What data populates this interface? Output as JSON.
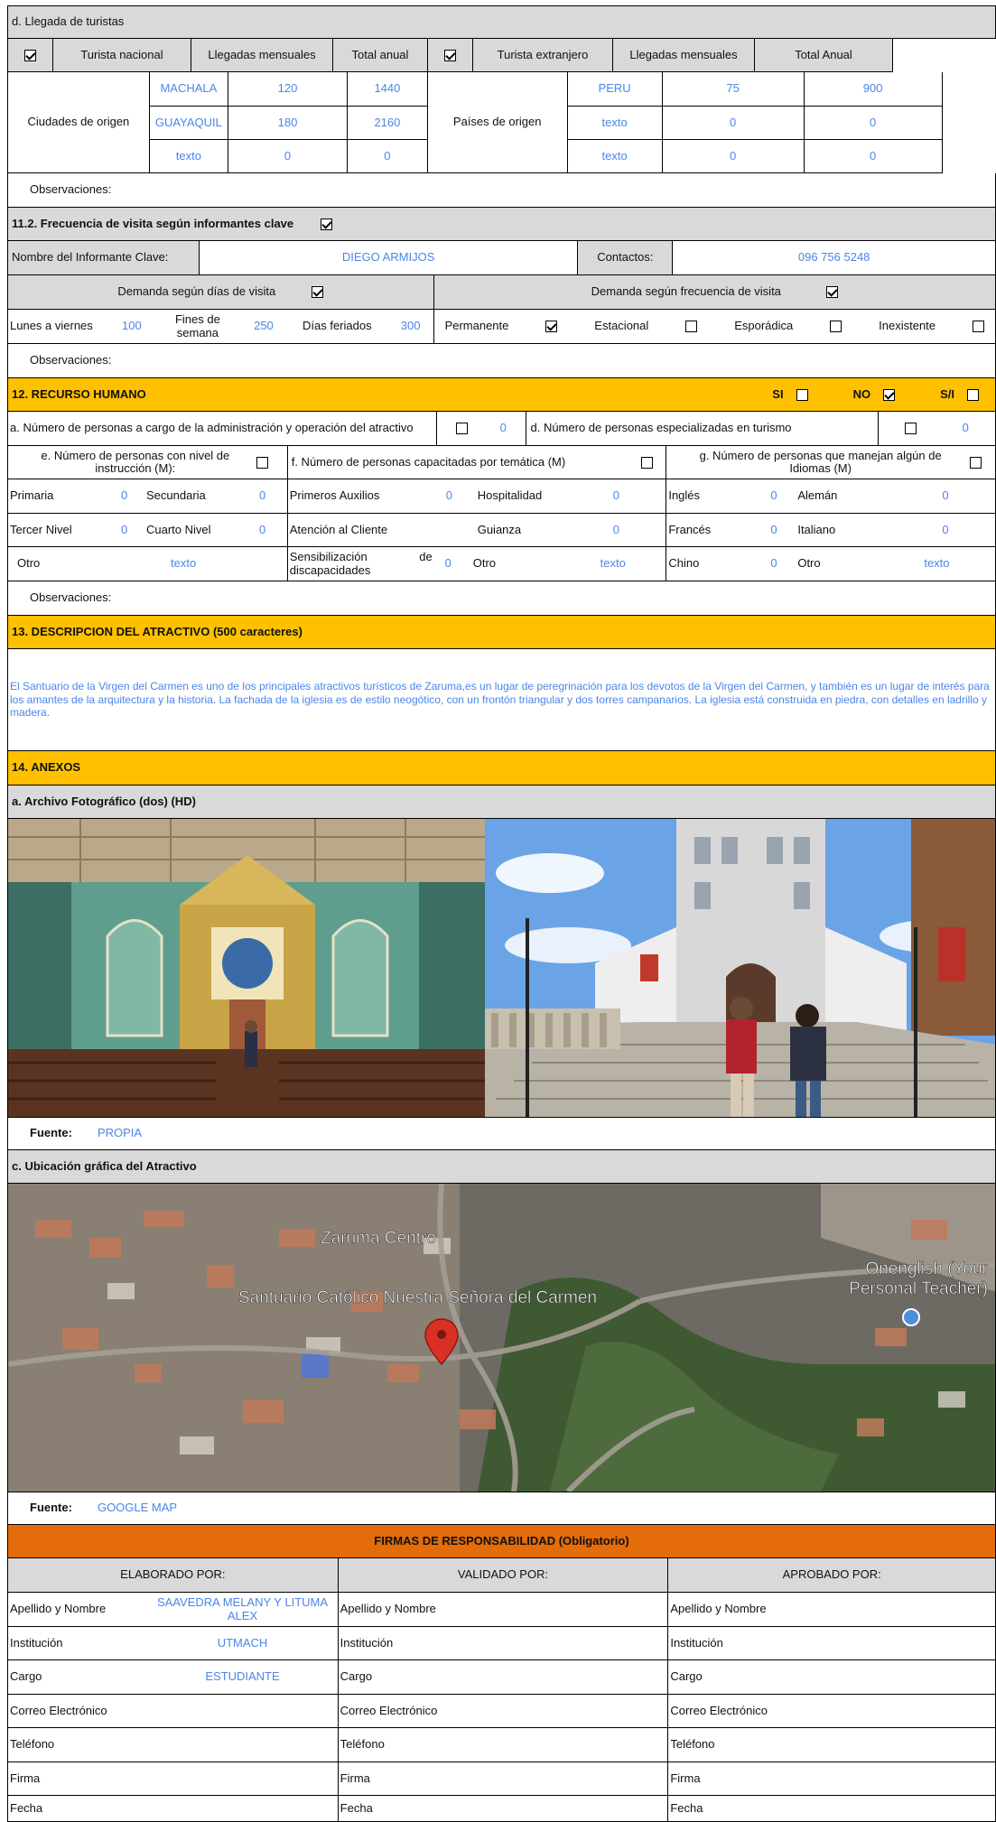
{
  "arrivals": {
    "section_title": "d. Llegada de turistas",
    "national": {
      "label": "Turista nacional",
      "checked": true,
      "col_monthly": "Llegadas mensuales",
      "col_total": "Total anual",
      "origin_label": "Ciudades de origen",
      "rows": [
        {
          "name": "MACHALA",
          "monthly": "120",
          "total": "1440"
        },
        {
          "name": "GUAYAQUIL",
          "monthly": "180",
          "total": "2160"
        },
        {
          "name": "texto",
          "monthly": "0",
          "total": "0"
        }
      ]
    },
    "foreign": {
      "label": "Turista extranjero",
      "checked": true,
      "col_monthly": "Llegadas mensuales",
      "col_total": "Total Anual",
      "origin_label": "Países de origen",
      "rows": [
        {
          "name": "PERU",
          "monthly": "75",
          "total": "900"
        },
        {
          "name": "texto",
          "monthly": "0",
          "total": "0"
        },
        {
          "name": "texto",
          "monthly": "0",
          "total": "0"
        }
      ]
    },
    "observations_label": "Observaciones:"
  },
  "frequency": {
    "title": "11.2. Frecuencia de visita según informantes clave",
    "checked": true,
    "informant_label": "Nombre del Informante Clave:",
    "informant_value": "DIEGO ARMIJOS",
    "contacts_label": "Contactos:",
    "contacts_value": "096 756 5248",
    "days_label": "Demanda según  días de visita",
    "days_checked": true,
    "freq_label": "Demanda según frecuencia de visita",
    "freq_checked": true,
    "weekday_label": "Lunes a viernes",
    "weekday_value": "100",
    "weekend_label": "Fines de semana",
    "weekend_value": "250",
    "holiday_label": "Días feriados",
    "holiday_value": "300",
    "options": [
      {
        "label": "Permanente",
        "checked": true
      },
      {
        "label": "Estacional",
        "checked": false
      },
      {
        "label": "Esporádica",
        "checked": false
      },
      {
        "label": "Inexistente",
        "checked": false
      }
    ],
    "observations_label": "Observaciones:"
  },
  "hr": {
    "title": "12. RECURSO HUMANO",
    "si_label": "SI",
    "si_checked": false,
    "no_label": "NO",
    "no_checked": true,
    "sn_label": "S/I",
    "sn_checked": false,
    "admin_label": "a. Número de personas a cargo de la administración y operación del atractivo",
    "admin_value": "0",
    "specialized_label": "d. Número de personas especializadas en turismo",
    "specialized_value": "0",
    "education_label": "e. Número de personas con nivel de instrucción (M):",
    "trained_label": "f. Número de personas capacitadas por temática (M)",
    "languages_label": "g. Número de personas que manejan algún de Idiomas (M)",
    "edu": {
      "primaria": "Primaria",
      "primaria_v": "0",
      "secundaria": "Secundaria",
      "secundaria_v": "0",
      "tercer": "Tercer Nivel",
      "tercer_v": "0",
      "cuarto": "Cuarto Nivel",
      "cuarto_v": "0",
      "otro": "Otro",
      "otro_v": "texto"
    },
    "trn": {
      "aux": "Primeros Auxilios",
      "aux_v": "0",
      "hosp": "Hospitalidad",
      "hosp_v": "0",
      "cliente": "Atención al Cliente",
      "guianza": "Guianza",
      "guianza_v": "0",
      "sens": "Sensibilización de discapacidades",
      "sens_v": "0",
      "otro": "Otro",
      "otro_v": "texto"
    },
    "lang": {
      "ingles": "Inglés",
      "ingles_v": "0",
      "aleman": "Alemán",
      "aleman_v": "0",
      "frances": "Francés",
      "frances_v": "0",
      "italiano": "Italiano",
      "italiano_v": "0",
      "chino": "Chino",
      "chino_v": "0",
      "otro": "Otro",
      "otro_v": "texto"
    },
    "observations_label": "Observaciones:"
  },
  "description": {
    "title": "13. DESCRIPCION DEL ATRACTIVO (500 caracteres)",
    "text": "El Santuario de la Virgen del Carmen es uno de los principales atractivos turísticos de Zaruma,es un lugar de peregrinación para los devotos de la Virgen del Carmen, y también es un lugar de interés para los amantes de la arquitectura y la historia. La fachada de la iglesia es de estilo neogótico, con un frontón triangular y dos torres campanarios. La iglesia está construida en piedra, con detalles en ladrillo y madera."
  },
  "annexes": {
    "title": "14. ANEXOS",
    "photo_title": "a. Archivo Fotográfico (dos) (HD)",
    "photo_source_label": "Fuente:",
    "photo_source_value": "PROPIA",
    "map_title": "c. Ubicación gráfica del Atractivo",
    "map_labels": {
      "center": "Zaruma Centro",
      "church": "Santuario Católico Nuestra Señora del Carmen",
      "poi_1": "Onenglish (Your",
      "poi_2": "Personal Teacher)"
    },
    "map_source_label": "Fuente:",
    "map_source_value": "GOOGLE MAP"
  },
  "signatures": {
    "title": "FIRMAS DE RESPONSABILIDAD (Obligatorio)",
    "columns": [
      "ELABORADO POR:",
      "VALIDADO  POR:",
      "APROBADO POR:"
    ],
    "rows": [
      {
        "label": "Apellido y Nombre",
        "value": "SAAVEDRA MELANY Y LITUMA ALEX"
      },
      {
        "label": "Institución",
        "value": "UTMACH"
      },
      {
        "label": "Cargo",
        "value": "ESTUDIANTE"
      },
      {
        "label": "Correo Electrónico",
        "value": ""
      },
      {
        "label": "Teléfono",
        "value": ""
      },
      {
        "label": "Firma",
        "value": ""
      },
      {
        "label": "Fecha",
        "value": ""
      }
    ]
  },
  "colors": {
    "accent_yellow": "#ffc000",
    "accent_orange": "#e46c0a",
    "value_blue": "#4a86e8",
    "header_gray": "#d9d9d9"
  }
}
